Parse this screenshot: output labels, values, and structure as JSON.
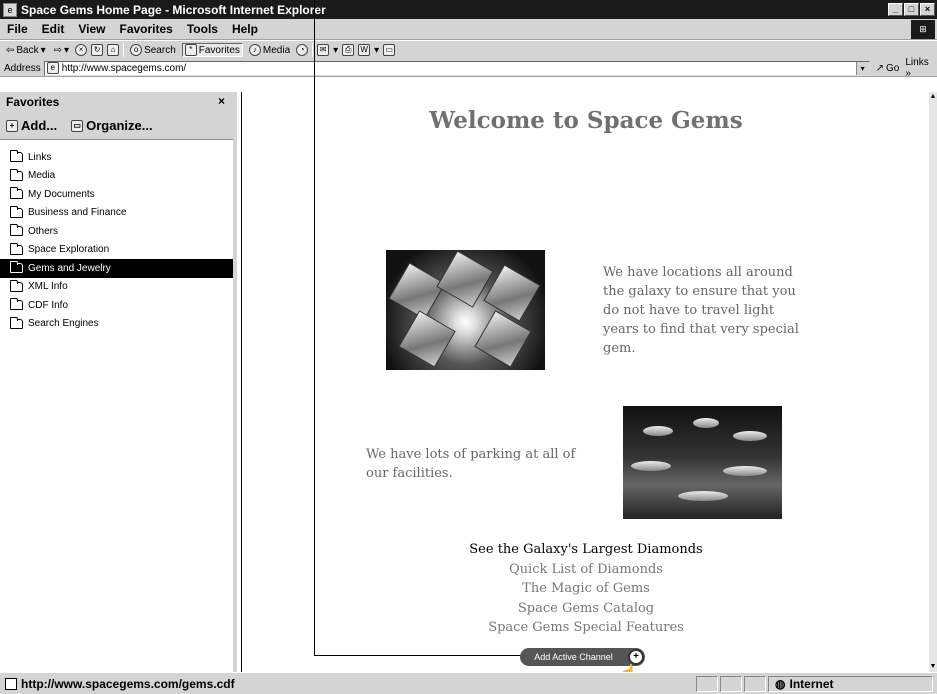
{
  "window": {
    "title": "Space Gems Home Page - Microsoft Internet Explorer"
  },
  "menu": [
    "File",
    "Edit",
    "View",
    "Favorites",
    "Tools",
    "Help"
  ],
  "toolbar": {
    "back": "Back",
    "search": "Search",
    "favorites": "Favorites",
    "media": "Media"
  },
  "address": {
    "label": "Address",
    "url": "http://www.spacegems.com/",
    "go": "Go",
    "links": "Links"
  },
  "favorites_pane": {
    "title": "Favorites",
    "close": "×",
    "add": "Add...",
    "organize": "Organize...",
    "items": [
      {
        "label": "Links"
      },
      {
        "label": "Media"
      },
      {
        "label": "My Documents"
      },
      {
        "label": "Business and Finance"
      },
      {
        "label": "Others"
      },
      {
        "label": "Space Exploration"
      },
      {
        "label": "Gems and Jewelry",
        "selected": true
      },
      {
        "label": "XML Info"
      },
      {
        "label": "CDF Info"
      },
      {
        "label": "Search Engines"
      }
    ]
  },
  "page": {
    "heading": "Welcome to Space Gems",
    "para1": "We have locations all around the galaxy to ensure that you do not have to travel light years to find that very special gem.",
    "para2": "We have lots of parking at all of our facilities.",
    "links_header": "See the Galaxy's Largest Diamonds",
    "links": [
      "Quick List of Diamonds",
      "The Magic of Gems",
      "Space Gems Catalog",
      "Space Gems Special Features"
    ],
    "channel_button": "Add Active Channel"
  },
  "status": {
    "text": "http://www.spacegems.com/gems.cdf",
    "zone": "Internet"
  }
}
